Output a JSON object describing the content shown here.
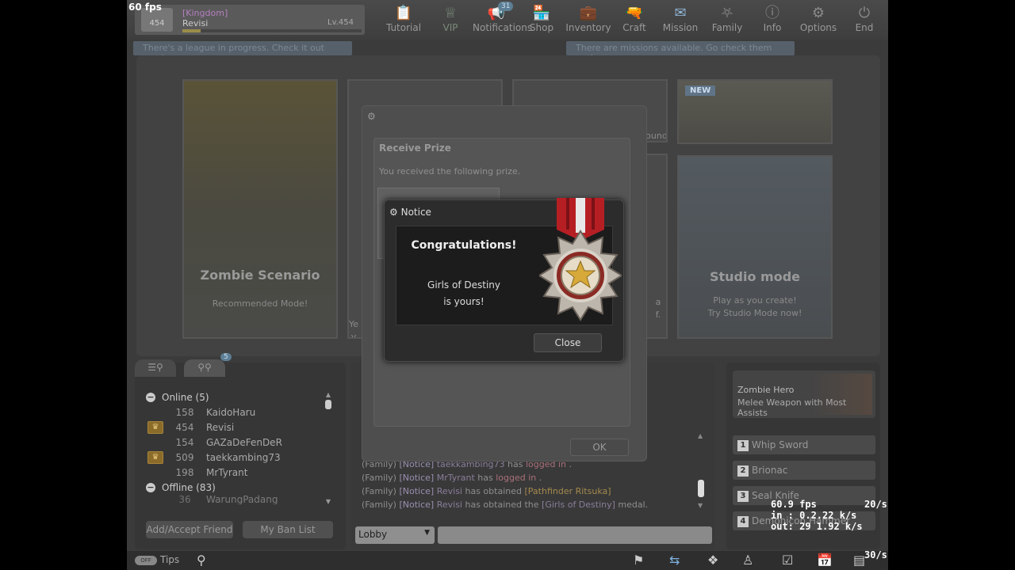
{
  "overlay": {
    "fps_top": "60 fps",
    "fps_stat": "60.9 fps",
    "rate1": "20/s",
    "in": "in : 0.2.22 k/s",
    "out": "out: 29 1.92 k/s",
    "rate2": "30/s"
  },
  "player": {
    "guild": "[Kingdom]",
    "name": "Revisi",
    "level_text": "Lv.454",
    "badge_level": "454",
    "xp_fraction": 0.1
  },
  "nav": [
    {
      "label": "Tutorial",
      "icon": "tutorial-icon"
    },
    {
      "label": "VIP",
      "icon": "vip-crown-icon"
    },
    {
      "label": "Notifications",
      "icon": "megaphone-icon",
      "count": "31"
    },
    {
      "label": "Shop",
      "icon": "shop-icon"
    },
    {
      "label": "Inventory",
      "icon": "inventory-icon"
    },
    {
      "label": "Craft",
      "icon": "craft-icon"
    },
    {
      "label": "Mission",
      "icon": "mission-icon"
    },
    {
      "label": "Family",
      "icon": "family-icon"
    },
    {
      "label": "Info",
      "icon": "info-icon"
    },
    {
      "label": "Options",
      "icon": "gear-icon"
    },
    {
      "label": "End",
      "icon": "power-icon"
    }
  ],
  "banners": {
    "league": "There's a league in progress. Check it out now!",
    "missions": "There are missions available. Go check them out!"
  },
  "modes": {
    "zombie": {
      "title": "Zombie Scenario",
      "sub": "Recommended Mode!"
    },
    "studio": {
      "title": "Studio mode",
      "sub1": "Play as you create!",
      "sub2": "Try Studio Mode now!"
    },
    "new_tag": "NEW",
    "partial": {
      "ound": "ound",
      "ye": "Ye",
      "v": "v",
      "a": "a",
      "f": "f."
    }
  },
  "friends": {
    "tab_badge": "5",
    "online_label": "Online (5)",
    "offline_label": "Offline (83)",
    "online": [
      {
        "level": "158",
        "name": "KaidoHaru",
        "crown": false
      },
      {
        "level": "454",
        "name": "Revisi",
        "crown": true
      },
      {
        "level": "154",
        "name": "GAZaDeFenDeR",
        "crown": false
      },
      {
        "level": "509",
        "name": "taekkambing73",
        "crown": true
      },
      {
        "level": "198",
        "name": "MrTyrant",
        "crown": false
      }
    ],
    "offline_first": {
      "level": "36",
      "name": "WarungPadang"
    },
    "add_btn": "Add/Accept Friend",
    "ban_btn": "My Ban List"
  },
  "chat": {
    "lines": [
      {
        "family": "(Family)",
        "notice": "[Notice]",
        "name": "taekkambing73",
        "mid": " has ",
        "act": "logged in",
        "end": " ."
      },
      {
        "family": "(Family)",
        "notice": "[Notice]",
        "name": "MrTyrant",
        "mid": " has ",
        "act": "logged in",
        "end": " ."
      },
      {
        "family": "(Family)",
        "notice": "[Notice]",
        "name": "Revisi",
        "mid": " has obtained ",
        "act": "[Pathfinder Ritsuka]",
        "end": ""
      },
      {
        "family": "(Family)",
        "notice": "[Notice]",
        "name": "Revisi",
        "mid": " has obtained the ",
        "act": "[Girls of Destiny]",
        "end": " medal."
      }
    ],
    "channel": "Lobby",
    "input_value": ""
  },
  "weapons": {
    "hero_title": "Zombie Hero",
    "hero_sub": "Melee Weapon with Most Assists",
    "slots": [
      {
        "n": "1",
        "name": "Whip Sword"
      },
      {
        "n": "2",
        "name": "Brionac"
      },
      {
        "n": "3",
        "name": "Seal Knife"
      },
      {
        "n": "4",
        "name": "Demonicon Hammer"
      }
    ]
  },
  "bottom": {
    "tips": "Tips",
    "toggle": "OFF"
  },
  "prize_dialog": {
    "title": "Receive Prize",
    "message": "You received the following prize.",
    "ok": "OK"
  },
  "notice": {
    "title": "Notice",
    "heading": "Congratulations!",
    "line1": "Girls of Destiny",
    "line2": "is yours!",
    "close": "Close"
  }
}
